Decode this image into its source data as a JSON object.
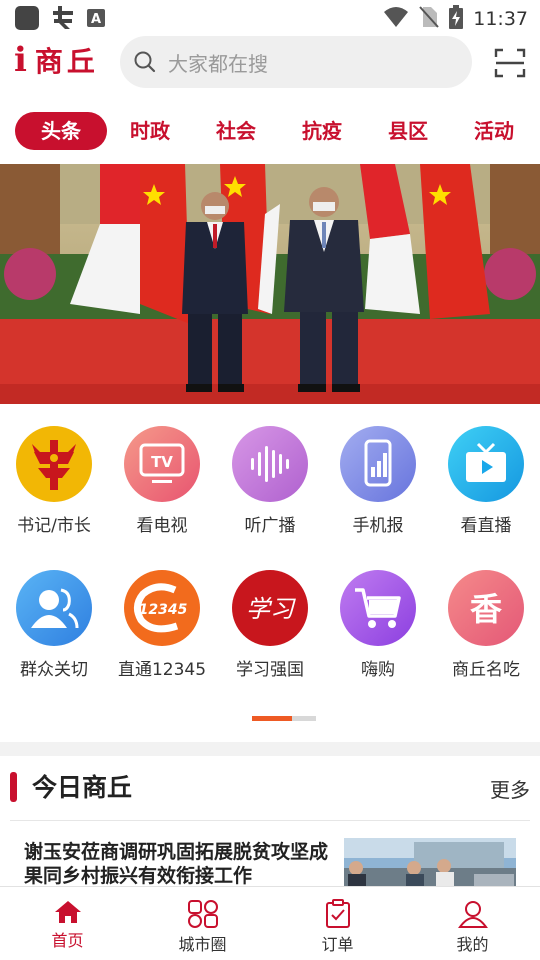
{
  "status_bar": {
    "time": "11:37",
    "left_icons": [
      "app-square-icon",
      "bug-icon",
      "keyboard-a-icon"
    ],
    "right_icons": [
      "wifi-icon",
      "no-sim-icon",
      "battery-charging-icon"
    ]
  },
  "header": {
    "logo_i": "i",
    "logo_text": "商丘",
    "search_placeholder": "大家都在搜",
    "scan_icon": "scan-icon"
  },
  "tabs": [
    {
      "label": "头条",
      "active": true
    },
    {
      "label": "时政",
      "active": false
    },
    {
      "label": "社会",
      "active": false
    },
    {
      "label": "抗疫",
      "active": false
    },
    {
      "label": "县区",
      "active": false
    },
    {
      "label": "活动",
      "active": false
    }
  ],
  "grid": [
    {
      "label": "书记/市长",
      "icon": "emblem-icon",
      "color": "#f2b705"
    },
    {
      "label": "看电视",
      "icon": "tv-icon",
      "color": "#ef6a6a"
    },
    {
      "label": "听广播",
      "icon": "soundwave-icon",
      "color": "#c77ddb"
    },
    {
      "label": "手机报",
      "icon": "phone-chart-icon",
      "color": "#7f8ee8"
    },
    {
      "label": "看直播",
      "icon": "live-tv-icon",
      "color": "#21b6ee"
    },
    {
      "label": "群众关切",
      "icon": "people-icon",
      "color": "#3f8fe8"
    },
    {
      "label": "直通12345",
      "icon": "hotline-12345-icon",
      "color": "#f26b1d",
      "badge": "12345"
    },
    {
      "label": "学习强国",
      "icon": "xuexi-icon",
      "color": "#c8161d",
      "badge": "学习"
    },
    {
      "label": "嗨购",
      "icon": "cart-icon",
      "color": "#a54ee8"
    },
    {
      "label": "商丘名吃",
      "icon": "xiang-icon",
      "color": "#ee6a7a",
      "badge": "香"
    }
  ],
  "section": {
    "title": "今日商丘",
    "more": "更多"
  },
  "news": {
    "headline": "谢玉安莅商调研巩固拓展脱贫攻坚成果同乡村振兴有效衔接工作"
  },
  "bottom_nav": [
    {
      "label": "首页",
      "icon": "home-icon",
      "active": true
    },
    {
      "label": "城市圈",
      "icon": "grid-circles-icon",
      "active": false
    },
    {
      "label": "订单",
      "icon": "order-clipboard-icon",
      "active": false
    },
    {
      "label": "我的",
      "icon": "user-icon",
      "active": false
    }
  ],
  "colors": {
    "brand_red": "#c8102e",
    "pager_active": "#ee5a24"
  }
}
